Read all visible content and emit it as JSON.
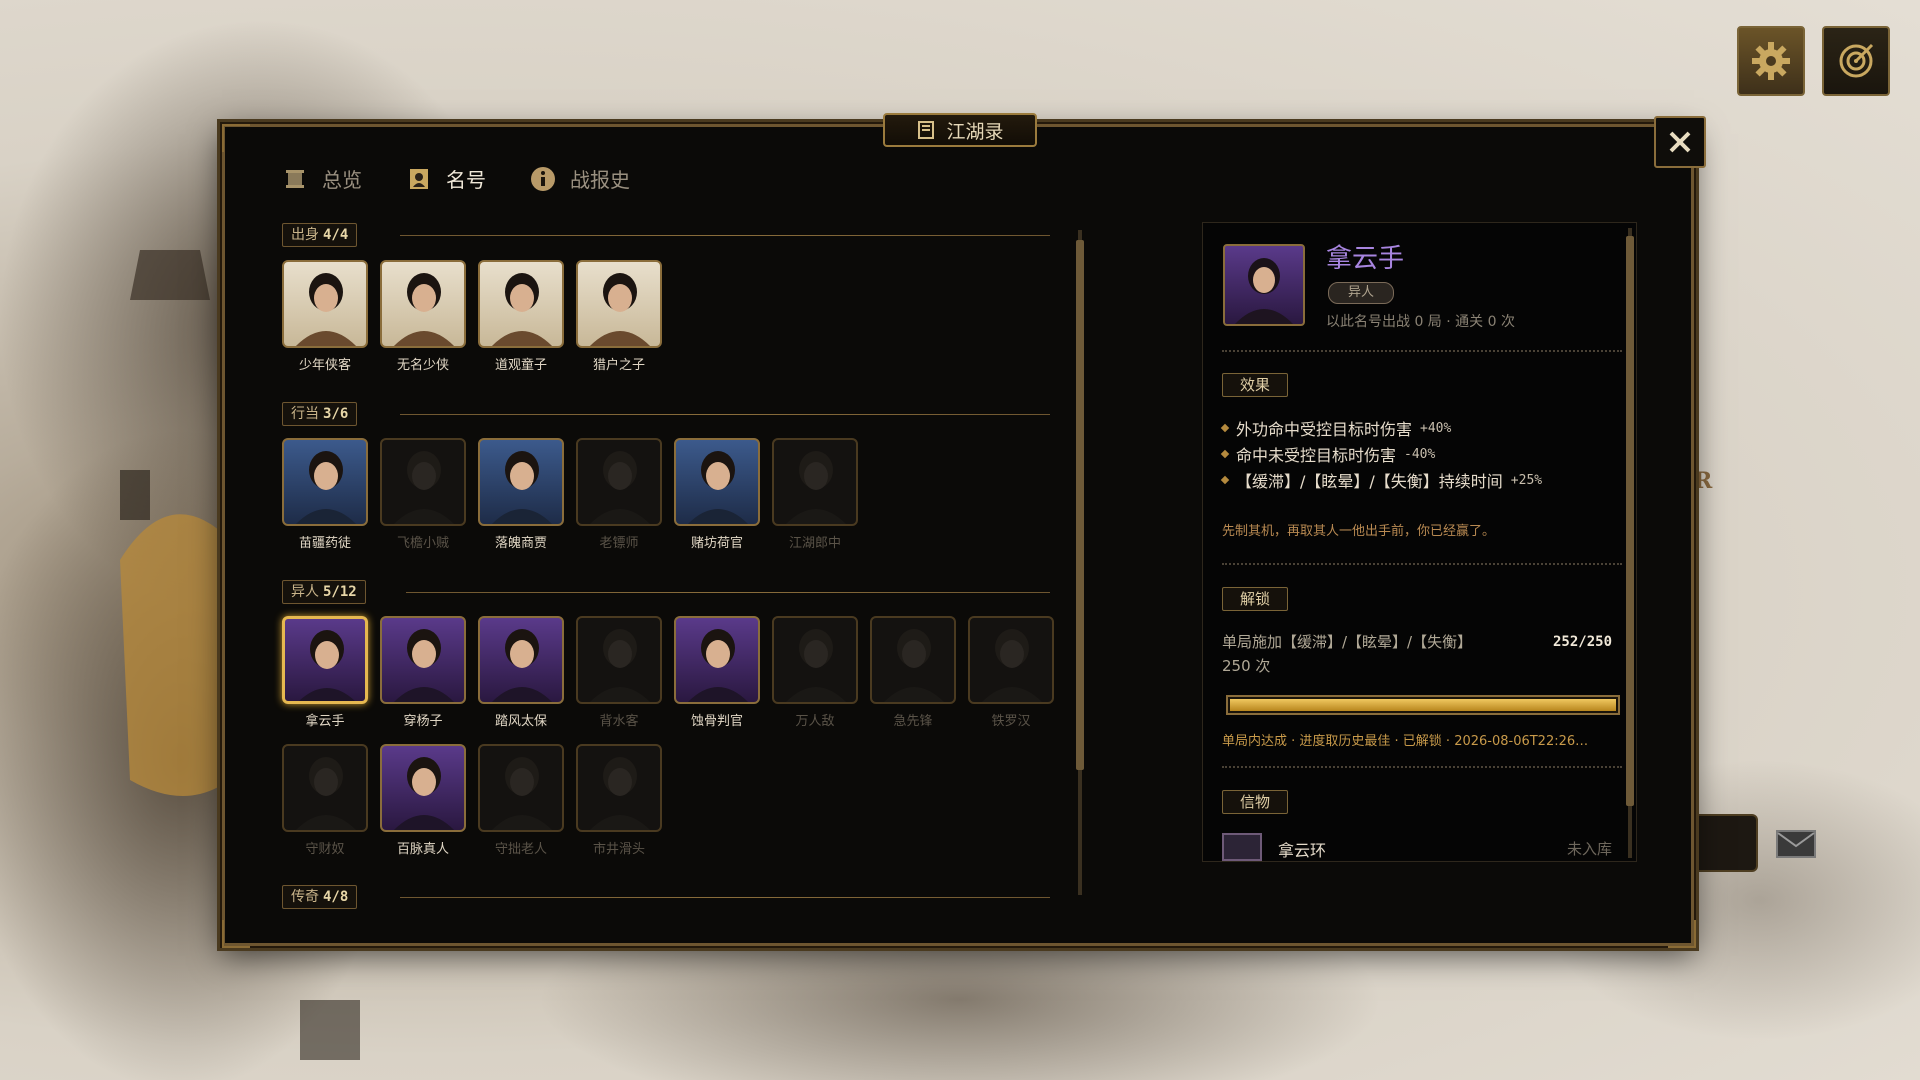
{
  "window": {
    "title": "江湖录"
  },
  "tabs": [
    {
      "label": "总览",
      "icon": "scroll-icon",
      "active": false
    },
    {
      "label": "名号",
      "icon": "portrait-icon",
      "active": true
    },
    {
      "label": "战报史",
      "icon": "info-icon",
      "active": false
    }
  ],
  "sections": [
    {
      "name": "出身",
      "count": "4/4",
      "items": [
        {
          "label": "少年侠客",
          "state": "unlocked"
        },
        {
          "label": "无名少侠",
          "state": "unlocked"
        },
        {
          "label": "道观童子",
          "state": "unlocked"
        },
        {
          "label": "猎户之子",
          "state": "unlocked"
        }
      ]
    },
    {
      "name": "行当",
      "count": "3/6",
      "items": [
        {
          "label": "苗疆药徒",
          "state": "unlocked"
        },
        {
          "label": "飞檐小贼",
          "state": "locked"
        },
        {
          "label": "落魄商贾",
          "state": "unlocked"
        },
        {
          "label": "老镖师",
          "state": "locked"
        },
        {
          "label": "赌坊荷官",
          "state": "unlocked"
        },
        {
          "label": "江湖郎中",
          "state": "locked"
        }
      ]
    },
    {
      "name": "异人",
      "count": "5/12",
      "items": [
        {
          "label": "拿云手",
          "state": "selected"
        },
        {
          "label": "穿杨子",
          "state": "unlocked"
        },
        {
          "label": "踏风太保",
          "state": "unlocked"
        },
        {
          "label": "背水客",
          "state": "locked"
        },
        {
          "label": "蚀骨判官",
          "state": "unlocked"
        },
        {
          "label": "万人敌",
          "state": "locked"
        },
        {
          "label": "急先锋",
          "state": "locked"
        },
        {
          "label": "铁罗汉",
          "state": "locked"
        },
        {
          "label": "守财奴",
          "state": "locked"
        },
        {
          "label": "百脉真人",
          "state": "unlocked"
        },
        {
          "label": "守拙老人",
          "state": "locked"
        },
        {
          "label": "市井滑头",
          "state": "locked"
        }
      ]
    },
    {
      "name": "传奇",
      "count": "4/8",
      "items": []
    }
  ],
  "detail": {
    "name": "拿云手",
    "tag": "异人",
    "stats": "以此名号出战 0 局 · 通关 0 次",
    "effect_header": "效果",
    "effects": [
      {
        "text": "外功命中受控目标时伤害",
        "value": "+40%"
      },
      {
        "text": "命中未受控目标时伤害",
        "value": "-40%"
      },
      {
        "text": "【缓滞】/【眩晕】/【失衡】持续时间",
        "value": "+25%"
      }
    ],
    "quote": "先制其机，再取其人一他出手前，你已经赢了。",
    "unlock_header": "解锁",
    "unlock_text": "单局施加【缓滞】/【眩晕】/【失衡】",
    "unlock_times": "250 次",
    "unlock_count": "252/250",
    "progress": 1.0,
    "progress_note": "单局内达成 · 进度取历史最佳 · 已解锁 · 2026-08-06T22:26…",
    "token_header": "信物",
    "token_name": "拿云环",
    "token_status": "未入库"
  },
  "background": {
    "stray_text": "R"
  },
  "colors": {
    "accent_gold": "#c89a30",
    "purple_rarity": "#a885e0",
    "frame": "#8a6d3b"
  }
}
